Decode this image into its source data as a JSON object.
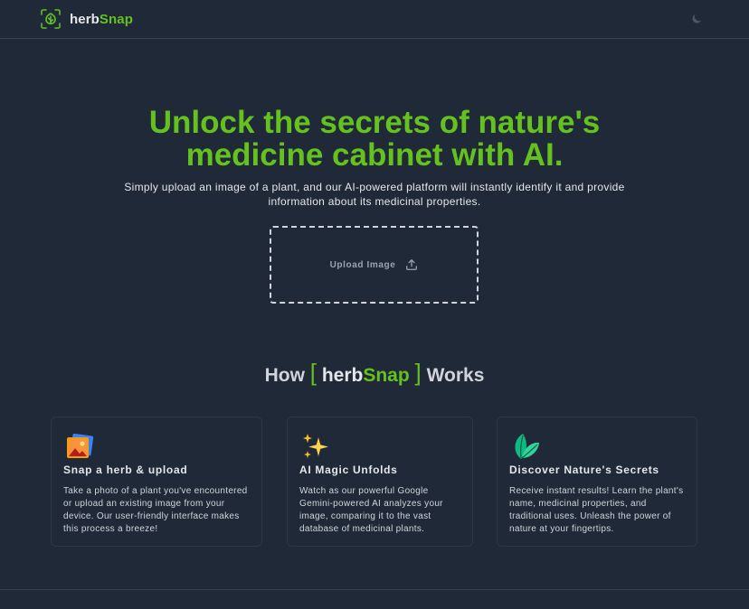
{
  "brand": {
    "name_part1": "herb",
    "name_part2": "Snap",
    "logo_icon": "leaf-scan-icon"
  },
  "navbar": {
    "theme_toggle_icon": "moon-icon"
  },
  "hero": {
    "title_line1": "Unlock the secrets of nature's",
    "title_line2": "medicine cabinet with AI.",
    "subtitle": "Simply upload an image of a plant, and our AI-powered platform will instantly identify it and provide information about its medicinal properties."
  },
  "upload": {
    "label": "Upload Image",
    "icon": "upload-icon"
  },
  "how": {
    "prefix": "How",
    "bracket_open": "[",
    "bracket_close": "]",
    "suffix": "Works",
    "brand_part1": "herb",
    "brand_part2": "Snap"
  },
  "cards": [
    {
      "icon": "image-icon",
      "title": "Snap a herb & upload",
      "text": "Take a photo of a plant you've encountered or upload an existing image from your device. Our user-friendly interface makes this process a breeze!"
    },
    {
      "icon": "sparkles-icon",
      "title": "AI Magic Unfolds",
      "text": "Watch as our powerful Google Gemini-powered AI analyzes your image, comparing it to the vast database of medicinal plants."
    },
    {
      "icon": "leaves-icon",
      "title": "Discover Nature's Secrets",
      "text": "Receive instant results! Learn the plant's name, medicinal properties, and traditional uses. Unleash the power of nature at your fingertips."
    }
  ],
  "colors": {
    "background": "#1f2937",
    "accent": "#65c21e",
    "text": "#e5e7eb",
    "muted": "#9ca3af",
    "border": "#374151"
  }
}
